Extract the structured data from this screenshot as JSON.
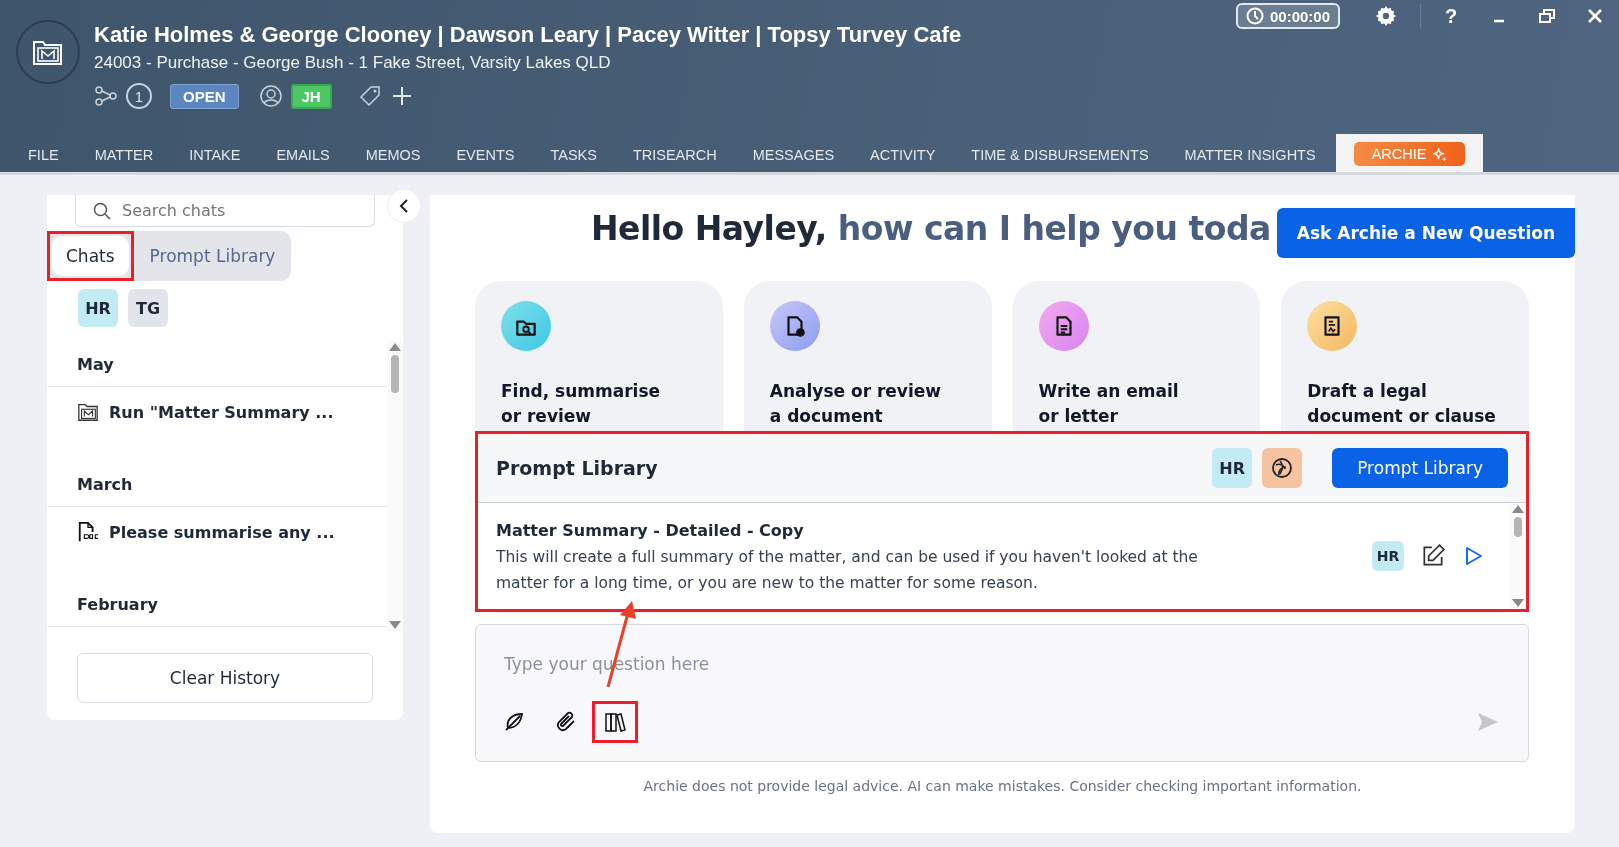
{
  "window": {
    "title": "Katie Holmes & George Clooney | Dawson Leary | Pacey Witter | Topsy Turvey Cafe",
    "subtitle": "24003  - Purchase - George Bush - 1 Fake Street, Varsity Lakes QLD"
  },
  "matter_badges": {
    "related_count": "1",
    "status": "OPEN",
    "assignee": "JH"
  },
  "timer": "00:00:00",
  "help": "?",
  "tabs": [
    {
      "label": "FILE",
      "selected": false
    },
    {
      "label": "MATTER",
      "selected": false
    },
    {
      "label": "INTAKE",
      "selected": false
    },
    {
      "label": "EMAILS",
      "selected": false
    },
    {
      "label": "MEMOS",
      "selected": false
    },
    {
      "label": "EVENTS",
      "selected": false
    },
    {
      "label": "TASKS",
      "selected": false
    },
    {
      "label": "TRISEARCH",
      "selected": false
    },
    {
      "label": "MESSAGES",
      "selected": false
    },
    {
      "label": "ACTIVITY",
      "selected": false
    },
    {
      "label": "TIME & DISBURSEMENTS",
      "selected": false
    },
    {
      "label": "MATTER INSIGHTS",
      "selected": false
    },
    {
      "label": "ARCHIE",
      "selected": true
    }
  ],
  "sidebar": {
    "search": {
      "placeholder": "Search chats"
    },
    "tabs": [
      {
        "label": "Chats",
        "selected": true
      },
      {
        "label": "Prompt Library",
        "selected": false
      }
    ],
    "users": [
      {
        "initials": "HR",
        "color": "#c3ebf3"
      },
      {
        "initials": "TG",
        "color": "#e1e4ea"
      }
    ],
    "groups": [
      {
        "label": "May",
        "chats": [
          {
            "title": "Run \"Matter Summary ...",
            "kind": "matter"
          }
        ]
      },
      {
        "label": "March",
        "chats": [
          {
            "title": "Please summarise any ...",
            "kind": "doc"
          }
        ]
      },
      {
        "label": "February"
      }
    ],
    "clear_button": "Clear History"
  },
  "main": {
    "greeting": "Hello Hayley, **how can I help you toda**",
    "new_question_button": "Ask Archie a New Question",
    "actions": [
      {
        "label": "Find, summarise\nor review",
        "kind": "find"
      },
      {
        "label": "Analyse or review\na document",
        "kind": "analyse"
      },
      {
        "label": "Write an email\nor letter",
        "kind": "write"
      },
      {
        "label": "Draft a legal\ndocument or clause",
        "kind": "draft"
      }
    ],
    "prompt_library": {
      "title": "Prompt Library",
      "owner": "HR",
      "button": "Prompt Library",
      "prompts": [
        {
          "title": "Matter Summary - Detailed - Copy",
          "description": "This will create a full summary of the matter, and can be used if you haven't looked at the matter for a long time, or you are new to the matter for some reason.",
          "owner": "HR"
        }
      ]
    },
    "composer": {
      "placeholder": "Type your question here"
    },
    "disclaimer": "Archie does not provide legal advice. AI can make mistakes. Consider checking important information."
  }
}
